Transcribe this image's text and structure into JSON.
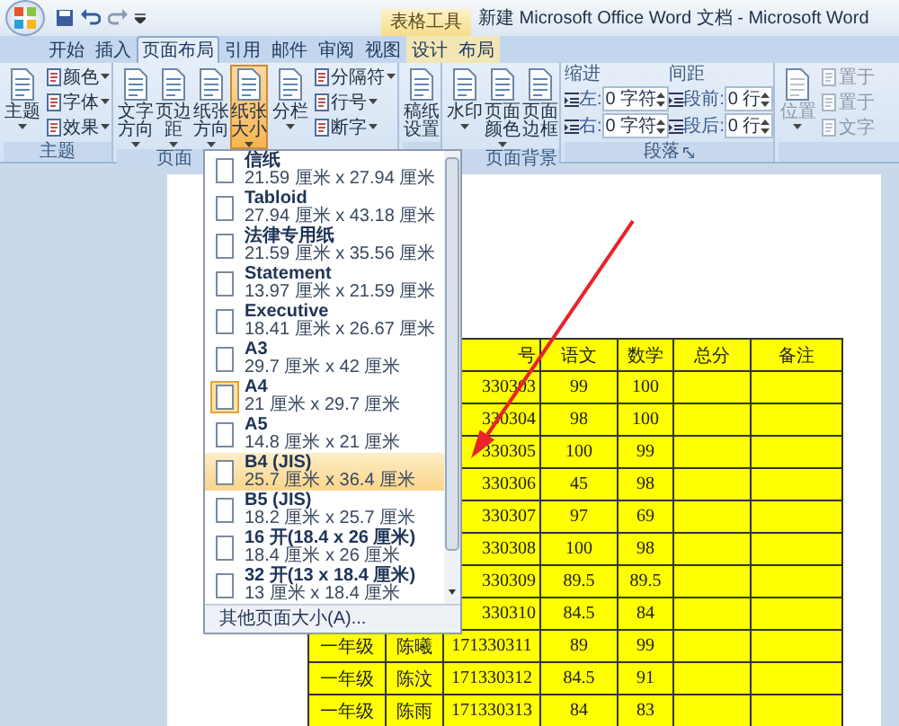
{
  "title_bar": {
    "contextual_tab": "表格工具",
    "title": "新建 Microsoft Office Word 文档 - Microsoft Word"
  },
  "tabs": [
    {
      "label": "开始",
      "selected": false,
      "contextual": false
    },
    {
      "label": "插入",
      "selected": false,
      "contextual": false
    },
    {
      "label": "页面布局",
      "selected": true,
      "contextual": false
    },
    {
      "label": "引用",
      "selected": false,
      "contextual": false
    },
    {
      "label": "邮件",
      "selected": false,
      "contextual": false
    },
    {
      "label": "审阅",
      "selected": false,
      "contextual": false
    },
    {
      "label": "视图",
      "selected": false,
      "contextual": false
    },
    {
      "label": "设计",
      "selected": false,
      "contextual": true
    },
    {
      "label": "布局",
      "selected": false,
      "contextual": true
    }
  ],
  "ribbon": {
    "groups": [
      {
        "kind": "buttons",
        "label": "主题",
        "launcher": false,
        "controls": [
          {
            "kind": "big",
            "label": "主题",
            "dropdown": true,
            "pressed": false
          },
          {
            "kind": "small",
            "label": "颜色",
            "dropdown": true
          },
          {
            "kind": "small",
            "label": "字体",
            "dropdown": true
          },
          {
            "kind": "small",
            "label": "效果",
            "dropdown": true
          }
        ]
      },
      {
        "kind": "buttons",
        "label": "页面",
        "launcher": false,
        "controls": [
          {
            "kind": "big",
            "label": "文字方向",
            "dropdown": true,
            "pressed": false
          },
          {
            "kind": "big",
            "label": "页边距",
            "dropdown": true,
            "pressed": false
          },
          {
            "kind": "big",
            "label": "纸张方向",
            "dropdown": true,
            "pressed": false
          },
          {
            "kind": "big",
            "label": "纸张大小",
            "dropdown": true,
            "pressed": true
          },
          {
            "kind": "big",
            "label": "分栏",
            "dropdown": true,
            "pressed": false
          },
          {
            "kind": "small",
            "label": "分隔符",
            "dropdown": true
          },
          {
            "kind": "small",
            "label": "行号",
            "dropdown": true
          },
          {
            "kind": "small",
            "label": "断字",
            "dropdown": true
          }
        ]
      },
      {
        "kind": "buttons",
        "controls": [
          {
            "kind": "big",
            "label": "稿纸设置",
            "dropdown": false,
            "pressed": false
          }
        ]
      },
      {
        "kind": "buttons",
        "label": "页面背景",
        "launcher": false,
        "controls": [
          {
            "kind": "big",
            "label": "水印",
            "dropdown": true,
            "pressed": false
          },
          {
            "kind": "big",
            "label": "页面颜色",
            "dropdown": true,
            "pressed": false
          },
          {
            "kind": "big",
            "label": "页面边框",
            "dropdown": false,
            "pressed": false
          }
        ]
      },
      {
        "kind": "paragraph",
        "label": "段落",
        "launcher": true,
        "sections": [
          {
            "heading": "缩进",
            "rows": [
              {
                "label": "左:",
                "value": "0 字符"
              },
              {
                "label": "右:",
                "value": "0 字符"
              }
            ]
          },
          {
            "heading": "间距",
            "rows": [
              {
                "label": "段前:",
                "value": "0 行"
              },
              {
                "label": "段后:",
                "value": "0 行"
              }
            ]
          }
        ]
      },
      {
        "kind": "buttons",
        "controls": [
          {
            "kind": "big",
            "label": "位置",
            "dropdown": true,
            "pressed": false,
            "disabled": true
          },
          {
            "kind": "small",
            "label": "置于",
            "dropdown": false,
            "disabled": true
          },
          {
            "kind": "small",
            "label": "置于",
            "dropdown": false,
            "disabled": true
          },
          {
            "kind": "small",
            "label": "文字",
            "dropdown": false,
            "disabled": true
          }
        ]
      }
    ]
  },
  "menu": {
    "items": [
      {
        "title": "信纸",
        "size": "21.59 厘米 x 27.94 厘米",
        "selected": false,
        "highlighted": false
      },
      {
        "title": "Tabloid",
        "size": "27.94 厘米 x 43.18 厘米",
        "selected": false,
        "highlighted": false
      },
      {
        "title": "法律专用纸",
        "size": "21.59 厘米 x 35.56 厘米",
        "selected": false,
        "highlighted": false
      },
      {
        "title": "Statement",
        "size": "13.97 厘米 x 21.59 厘米",
        "selected": false,
        "highlighted": false
      },
      {
        "title": "Executive",
        "size": "18.41 厘米 x 26.67 厘米",
        "selected": false,
        "highlighted": false
      },
      {
        "title": "A3",
        "size": "29.7 厘米 x 42 厘米",
        "selected": false,
        "highlighted": false
      },
      {
        "title": "A4",
        "size": "21 厘米 x 29.7 厘米",
        "selected": true,
        "highlighted": false
      },
      {
        "title": "A5",
        "size": "14.8 厘米 x 21 厘米",
        "selected": false,
        "highlighted": false
      },
      {
        "title": "B4 (JIS)",
        "size": "25.7 厘米 x 36.4 厘米",
        "selected": false,
        "highlighted": true
      },
      {
        "title": "B5 (JIS)",
        "size": "18.2 厘米 x 25.7 厘米",
        "selected": false,
        "highlighted": false
      },
      {
        "title": "16 开(18.4 x 26 厘米)",
        "size": "18.4 厘米 x 26 厘米",
        "selected": false,
        "highlighted": false
      },
      {
        "title": "32 开(13 x 18.4 厘米)",
        "size": "13 厘米 x 18.4 厘米",
        "selected": false,
        "highlighted": false
      }
    ],
    "footer": "其他页面大小(A)..."
  },
  "table": {
    "columns": [
      "号",
      "语文",
      "数学",
      "总分",
      "备注"
    ],
    "rows": [
      {
        "id": "330303",
        "chinese": "99",
        "math": "100"
      },
      {
        "id": "330304",
        "chinese": "98",
        "math": "100"
      },
      {
        "id": "330305",
        "chinese": "100",
        "math": "99"
      },
      {
        "id": "330306",
        "chinese": "45",
        "math": "98"
      },
      {
        "id": "330307",
        "chinese": "97",
        "math": "69"
      },
      {
        "id": "330308",
        "chinese": "100",
        "math": "98"
      },
      {
        "id": "330309",
        "chinese": "89.5",
        "math": "89.5"
      },
      {
        "id": "330310",
        "chinese": "84.5",
        "math": "84"
      },
      {
        "grade": "一年级",
        "name": "陈曦",
        "id": "171330311",
        "chinese": "89",
        "math": "99"
      },
      {
        "grade": "一年级",
        "name": "陈汶",
        "id": "171330312",
        "chinese": "84.5",
        "math": "91"
      },
      {
        "grade": "一年级",
        "name": "陈雨",
        "id": "171330313",
        "chinese": "84",
        "math": "83"
      }
    ]
  }
}
